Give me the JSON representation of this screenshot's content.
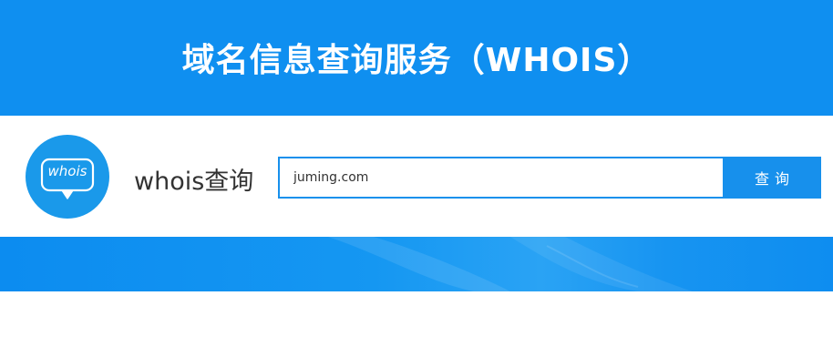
{
  "banner": {
    "title": "域名信息查询服务（WHOIS）"
  },
  "logo": {
    "text": "whois",
    "icon": "speech-bubble-icon"
  },
  "search": {
    "label": "whois查询",
    "value": "juming.com",
    "button_label": "查询"
  },
  "colors": {
    "primary_blue": "#0f8ff0",
    "button_blue": "#1790ec",
    "logo_blue": "#1a99ea",
    "label_text": "#333333"
  }
}
